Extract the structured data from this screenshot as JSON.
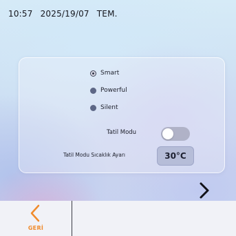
{
  "status_bar": {
    "time": "10:57",
    "date": "2025/19/07",
    "label": "TEM."
  },
  "mode_options": [
    {
      "label": "Smart",
      "selected": true
    },
    {
      "label": "Powerful",
      "selected": false
    },
    {
      "label": "Silent",
      "selected": false
    }
  ],
  "holiday_mode": {
    "label": "Tatil Modu",
    "enabled": false
  },
  "holiday_temperature": {
    "label": "Tatil Modu Sıcaklık Ayarı",
    "value": "30°C"
  },
  "navigation": {
    "back_label": "GERİ",
    "next_icon": "chevron-right-icon",
    "back_icon": "chevron-left-icon"
  },
  "colors": {
    "accent": "#f08b2c",
    "radio_fill": "#5d6786",
    "value_box": "#b6bdd8"
  }
}
